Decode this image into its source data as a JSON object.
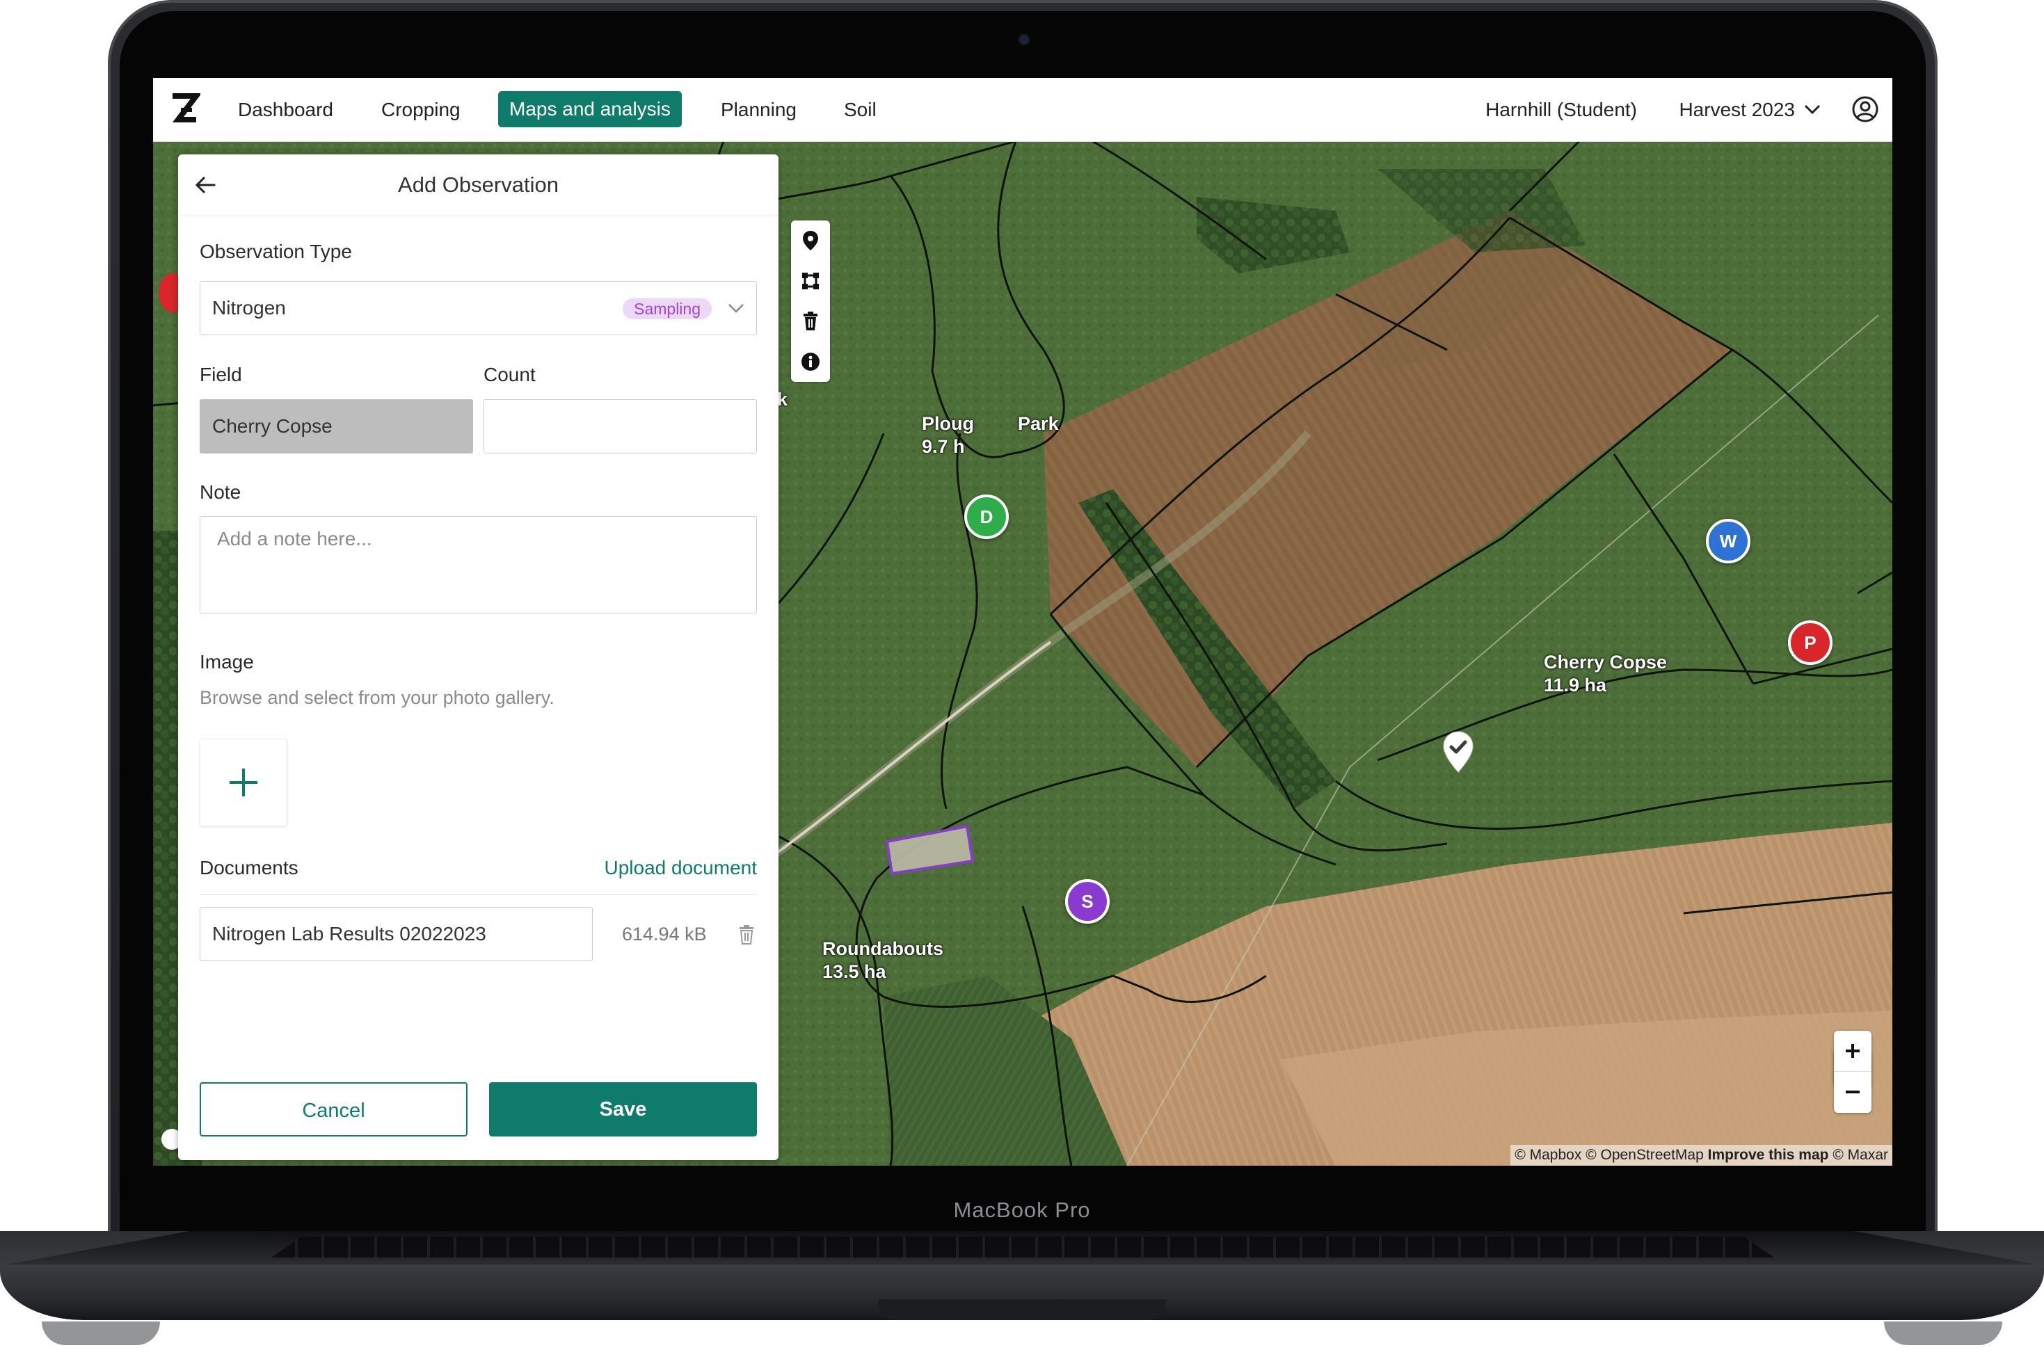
{
  "device": {
    "brand_label": "MacBook Pro"
  },
  "nav": {
    "items": [
      {
        "label": "Dashboard",
        "active": false
      },
      {
        "label": "Cropping",
        "active": false
      },
      {
        "label": "Maps and analysis",
        "active": true
      },
      {
        "label": "Planning",
        "active": false
      },
      {
        "label": "Soil",
        "active": false
      }
    ],
    "user": "Harnhill (Student)",
    "harvest": "Harvest 2023",
    "accent_color": "#0f7c6b"
  },
  "panel": {
    "title": "Add Observation",
    "observation_type": {
      "label": "Observation Type",
      "value": "Nitrogen",
      "badge": "Sampling"
    },
    "field": {
      "label": "Field",
      "value": "Cherry Copse"
    },
    "count": {
      "label": "Count",
      "value": ""
    },
    "note": {
      "label": "Note",
      "placeholder": "Add a note here..."
    },
    "image": {
      "label": "Image",
      "hint": "Browse and select from your photo gallery."
    },
    "documents": {
      "label": "Documents",
      "upload_label": "Upload document",
      "items": [
        {
          "name": "Nitrogen Lab Results 02022023",
          "size": "614.94 kB"
        }
      ]
    },
    "cancel_label": "Cancel",
    "save_label": "Save"
  },
  "map": {
    "fields": [
      {
        "name_left": "Ploug",
        "name_right": "Park",
        "area": "9.7 h"
      },
      {
        "name": "Cherry Copse",
        "area": "11.9 ha"
      },
      {
        "name": "Roundabouts",
        "area": "13.5 ha"
      }
    ],
    "edge_fragment": "k",
    "markers": [
      {
        "letter": "D",
        "color": "#2eae4a"
      },
      {
        "letter": "W",
        "color": "#2f72d6"
      },
      {
        "letter": "P",
        "color": "#d8262b"
      },
      {
        "letter": "S",
        "color": "#8a3bcf"
      }
    ],
    "attribution": {
      "mapbox": "© Mapbox",
      "osm": "© OpenStreetMap",
      "improve": "Improve this map",
      "maxar": "© Maxar"
    }
  }
}
